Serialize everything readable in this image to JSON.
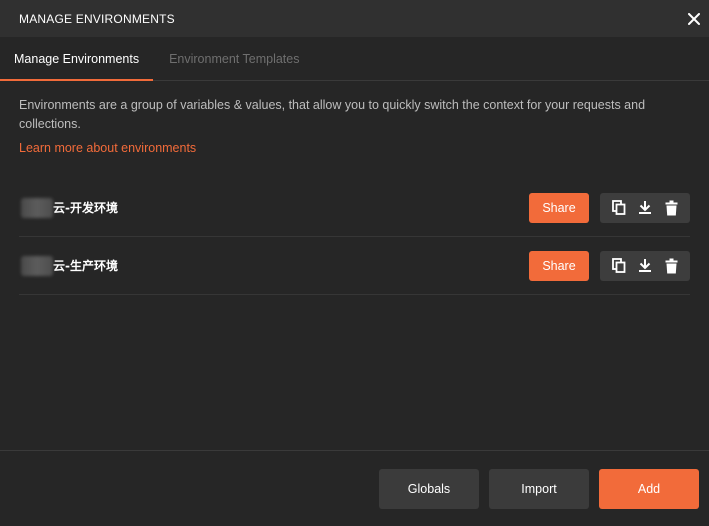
{
  "header": {
    "title": "MANAGE ENVIRONMENTS",
    "close_icon": "close-icon"
  },
  "tabs": [
    {
      "label": "Manage Environments",
      "active": true
    },
    {
      "label": "Environment Templates",
      "active": false
    }
  ],
  "description": "Environments are a group of variables & values, that allow you to quickly switch the context for your requests and collections.",
  "learn_more": "Learn more about environments",
  "environments": [
    {
      "name": "云-开发环境",
      "share_label": "Share"
    },
    {
      "name": "云-生产环境",
      "share_label": "Share"
    }
  ],
  "row_icons": [
    "duplicate-icon",
    "download-icon",
    "trash-icon"
  ],
  "footer": {
    "globals_label": "Globals",
    "import_label": "Import",
    "add_label": "Add"
  },
  "colors": {
    "accent": "#f26b3a",
    "background": "#262626",
    "header": "#303030"
  }
}
